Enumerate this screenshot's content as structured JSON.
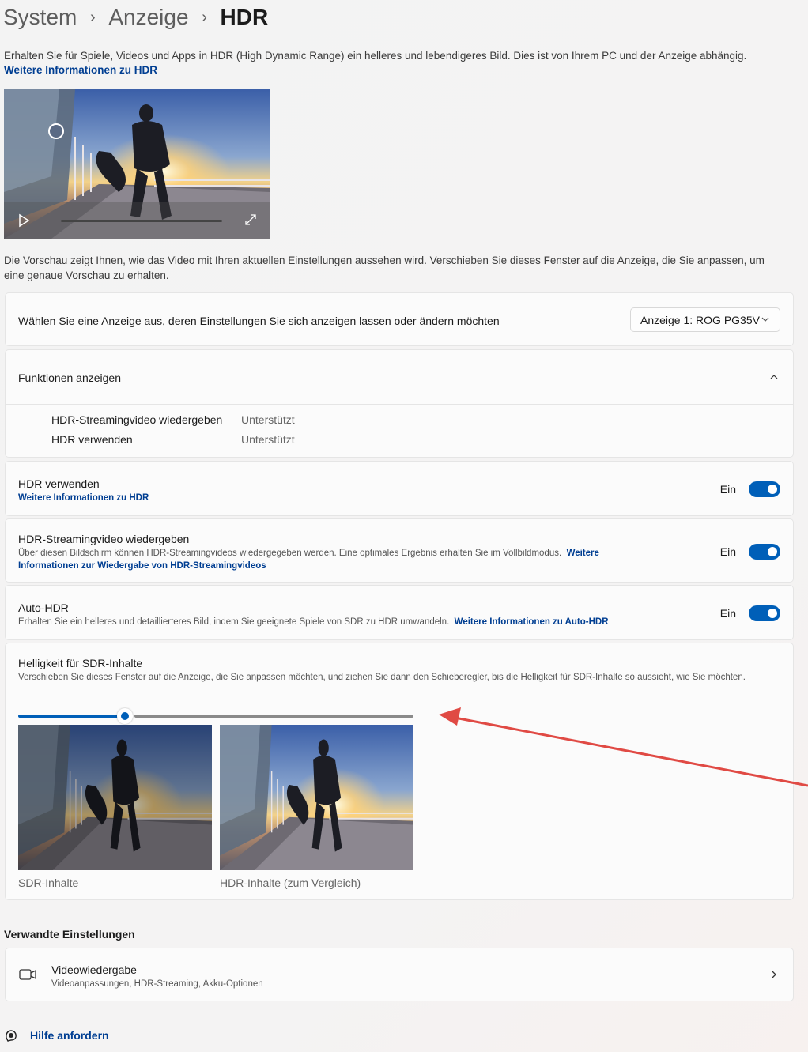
{
  "breadcrumb": {
    "items": [
      "System",
      "Anzeige"
    ],
    "current": "HDR"
  },
  "intro": {
    "text": "Erhalten Sie für Spiele, Videos und Apps in HDR (High Dynamic Range) ein helleres und lebendigeres Bild. Dies ist von Ihrem PC und der Anzeige abhängig.",
    "link": "Weitere Informationen zu HDR"
  },
  "video_preview": {
    "progress": 0
  },
  "preview_text": "Die Vorschau zeigt Ihnen, wie das Video mit Ihren aktuellen Einstellungen aussehen wird. Verschieben Sie dieses Fenster auf die Anzeige, die Sie anpassen, um eine genaue Vorschau zu erhalten.",
  "display_select": {
    "label": "Wählen Sie eine Anzeige aus, deren Einstellungen Sie sich anzeigen lassen oder ändern möchten",
    "value": "Anzeige 1: ROG PG35V"
  },
  "features": {
    "title": "Funktionen anzeigen",
    "rows": [
      {
        "name": "HDR-Streamingvideo wiedergeben",
        "value": "Unterstützt"
      },
      {
        "name": "HDR verwenden",
        "value": "Unterstützt"
      }
    ]
  },
  "use_hdr": {
    "title": "HDR verwenden",
    "link": "Weitere Informationen zu HDR",
    "state": "Ein",
    "on": true
  },
  "hdr_streaming": {
    "title": "HDR-Streamingvideo wiedergeben",
    "desc": "Über diesen Bildschirm können HDR-Streamingvideos wiedergegeben werden. Eine optimales Ergebnis erhalten Sie im Vollbildmodus.",
    "link": "Weitere Informationen zur Wiedergabe von HDR-Streamingvideos",
    "state": "Ein",
    "on": true
  },
  "auto_hdr": {
    "title": "Auto-HDR",
    "desc": "Erhalten Sie ein helleres und detaillierteres Bild, indem Sie geeignete Spiele von SDR zu HDR umwandeln.",
    "link": "Weitere Informationen zu Auto-HDR",
    "state": "Ein",
    "on": true
  },
  "sdr_brightness": {
    "title": "Helligkeit für SDR-Inhalte",
    "desc": "Verschieben Sie dieses Fenster auf die Anzeige, die Sie anpassen möchten, und ziehen Sie dann den Schieberegler, bis die Helligkeit für SDR-Inhalte so aussieht, wie Sie möchten.",
    "value_fraction": 0.27,
    "sdr_caption": "SDR-Inhalte",
    "hdr_caption": "HDR-Inhalte (zum Vergleich)"
  },
  "related": {
    "heading": "Verwandte Einstellungen",
    "items": [
      {
        "title": "Videowiedergabe",
        "desc": "Videoanpassungen, HDR-Streaming, Akku-Optionen"
      }
    ]
  },
  "help": {
    "label": "Hilfe anfordern"
  },
  "colors": {
    "accent": "#005fb8",
    "link": "#003e92",
    "annotation_arrow": "#e04a44"
  }
}
